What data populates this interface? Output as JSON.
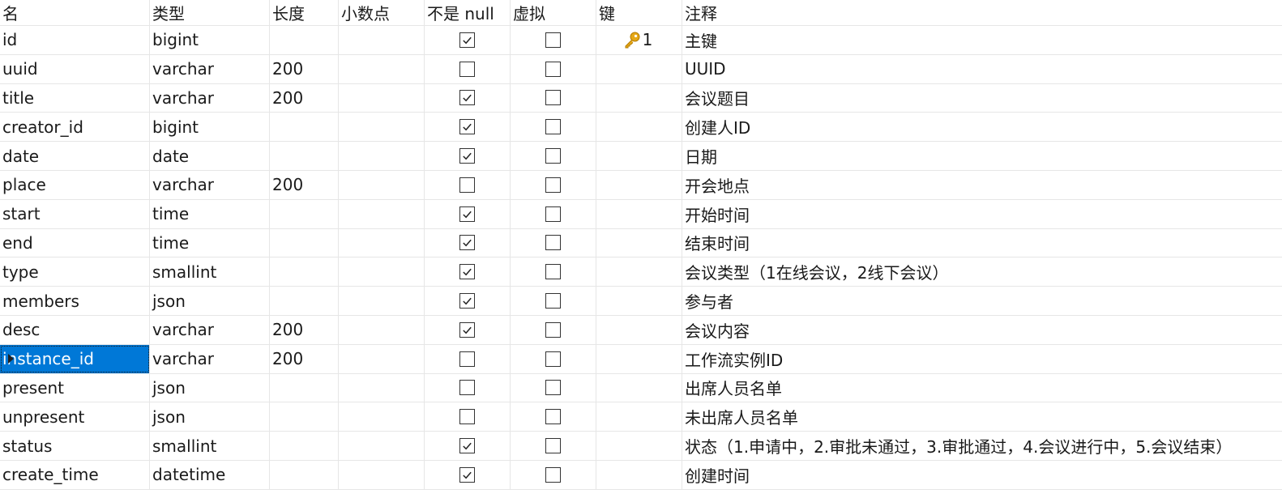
{
  "columns": {
    "name": "名",
    "type": "类型",
    "length": "长度",
    "decimals": "小数点",
    "not_null": "不是 null",
    "virtual": "虚拟",
    "key": "键",
    "comment": "注释"
  },
  "rows": [
    {
      "name": "id",
      "type": "bigint",
      "length": "",
      "not_null": true,
      "virtual": false,
      "key": "1",
      "comment": "主键"
    },
    {
      "name": "uuid",
      "type": "varchar",
      "length": "200",
      "not_null": false,
      "virtual": false,
      "key": "",
      "comment": "UUID"
    },
    {
      "name": "title",
      "type": "varchar",
      "length": "200",
      "not_null": true,
      "virtual": false,
      "key": "",
      "comment": "会议题目"
    },
    {
      "name": "creator_id",
      "type": "bigint",
      "length": "",
      "not_null": true,
      "virtual": false,
      "key": "",
      "comment": "创建人ID"
    },
    {
      "name": "date",
      "type": "date",
      "length": "",
      "not_null": true,
      "virtual": false,
      "key": "",
      "comment": "日期"
    },
    {
      "name": "place",
      "type": "varchar",
      "length": "200",
      "not_null": false,
      "virtual": false,
      "key": "",
      "comment": "开会地点"
    },
    {
      "name": "start",
      "type": "time",
      "length": "",
      "not_null": true,
      "virtual": false,
      "key": "",
      "comment": "开始时间"
    },
    {
      "name": "end",
      "type": "time",
      "length": "",
      "not_null": true,
      "virtual": false,
      "key": "",
      "comment": "结束时间"
    },
    {
      "name": "type",
      "type": "smallint",
      "length": "",
      "not_null": true,
      "virtual": false,
      "key": "",
      "comment": "会议类型（1在线会议，2线下会议）"
    },
    {
      "name": "members",
      "type": "json",
      "length": "",
      "not_null": true,
      "virtual": false,
      "key": "",
      "comment": "参与者"
    },
    {
      "name": "desc",
      "type": "varchar",
      "length": "200",
      "not_null": true,
      "virtual": false,
      "key": "",
      "comment": "会议内容"
    },
    {
      "name": "instance_id",
      "type": "varchar",
      "length": "200",
      "not_null": false,
      "virtual": false,
      "key": "",
      "comment": "工作流实例ID",
      "selected": true
    },
    {
      "name": "present",
      "type": "json",
      "length": "",
      "not_null": false,
      "virtual": false,
      "key": "",
      "comment": "出席人员名单"
    },
    {
      "name": "unpresent",
      "type": "json",
      "length": "",
      "not_null": false,
      "virtual": false,
      "key": "",
      "comment": "未出席人员名单"
    },
    {
      "name": "status",
      "type": "smallint",
      "length": "",
      "not_null": true,
      "virtual": false,
      "key": "",
      "comment": "状态（1.申请中，2.审批未通过，3.审批通过，4.会议进行中，5.会议结束）"
    },
    {
      "name": "create_time",
      "type": "datetime",
      "length": "",
      "not_null": true,
      "virtual": false,
      "key": "",
      "comment": "创建时间"
    }
  ],
  "colors": {
    "selection": "#0078d7",
    "key_icon": "#e6a817",
    "grid_line": "#e6e6e6"
  },
  "icons": {
    "key": "key-icon",
    "check": "checkmark-icon",
    "row_indicator": "row-pointer-icon"
  }
}
